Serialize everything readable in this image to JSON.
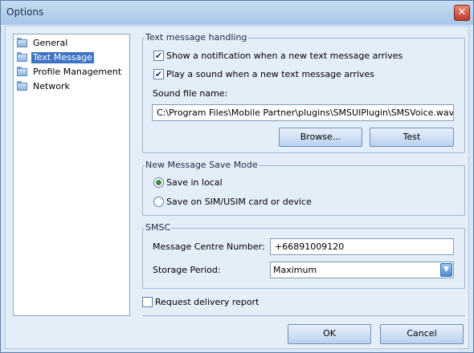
{
  "window": {
    "title": "Options",
    "close_glyph": "✕"
  },
  "tree": {
    "items": [
      {
        "label": "General",
        "icon": "folder-icon",
        "selected": false
      },
      {
        "label": "Text Message",
        "icon": "folder-open-icon",
        "selected": true
      },
      {
        "label": "Profile Management",
        "icon": "folder-icon",
        "selected": false
      },
      {
        "label": "Network",
        "icon": "folder-icon",
        "selected": false
      }
    ]
  },
  "text_handling": {
    "title": "Text message handling",
    "show_notification": {
      "label": "Show a notification when a new text message arrives",
      "checked": true
    },
    "play_sound": {
      "label": "Play a sound when a new text message arrives",
      "checked": true
    },
    "sound_file_label": "Sound file name:",
    "sound_file_value": "C:\\Program Files\\Mobile Partner\\plugins\\SMSUIPlugin\\SMSVoice.wav",
    "browse_label": "Browse...",
    "test_label": "Test"
  },
  "save_mode": {
    "title": "New Message Save Mode",
    "options": [
      {
        "label": "Save in local",
        "selected": true
      },
      {
        "label": "Save on SIM/USIM card or device",
        "selected": false
      }
    ]
  },
  "smsc": {
    "title": "SMSC",
    "centre_label": "Message Centre Number:",
    "centre_value": "+66891009120",
    "storage_label": "Storage Period:",
    "storage_value": "Maximum"
  },
  "delivery_report": {
    "label": "Request delivery report",
    "checked": false
  },
  "buttons": {
    "ok": "OK",
    "cancel": "Cancel"
  }
}
